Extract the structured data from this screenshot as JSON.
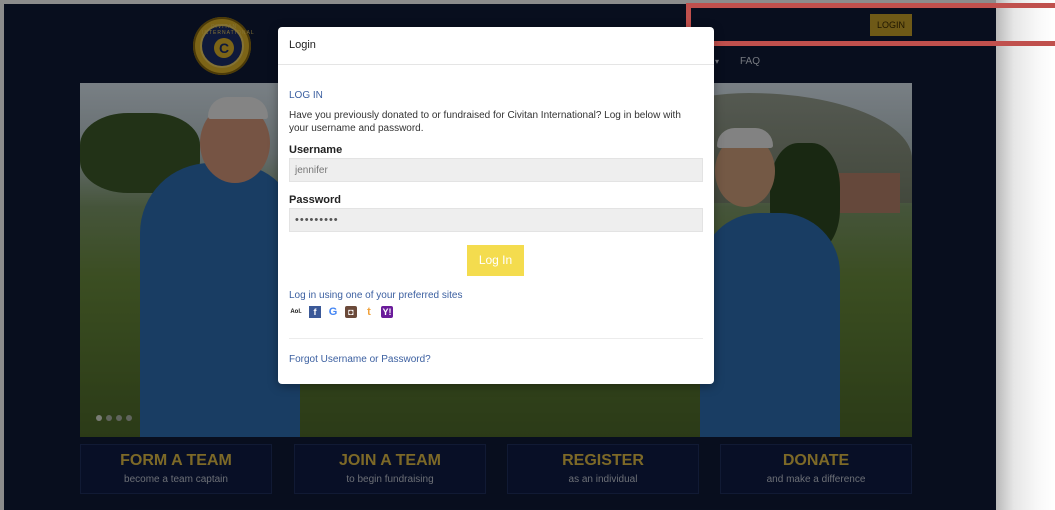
{
  "site": {
    "logo_text": "CIVITAN INTERNATIONAL",
    "logo_letter": "C",
    "nav": {
      "login_label": "LOGIN",
      "faq_label": "FAQ"
    }
  },
  "hero": {
    "slide_dots": 4,
    "active_slide": 1
  },
  "actions": [
    {
      "title": "FORM A TEAM",
      "subtitle": "become a team captain"
    },
    {
      "title": "JOIN A TEAM",
      "subtitle": "to begin fundraising"
    },
    {
      "title": "REGISTER",
      "subtitle": "as an individual"
    },
    {
      "title": "DONATE",
      "subtitle": "and make a difference"
    }
  ],
  "modal": {
    "title": "Login",
    "section_heading": "LOG IN",
    "description": "Have you previously donated to or fundraised for Civitan International? Log in below with your username and password.",
    "username_label": "Username",
    "username_value": "jennifer",
    "password_label": "Password",
    "password_value": "•••••••••",
    "login_button": "Log In",
    "preferred_sites_label": "Log in using one of your preferred sites",
    "social_icons": [
      "aol-icon",
      "facebook-icon",
      "google-icon",
      "instagram-icon",
      "tumblr-icon",
      "yahoo-icon"
    ],
    "forgot_link": "Forgot Username or Password?"
  },
  "colors": {
    "navy": "#0f1b38",
    "gold": "#e3bf48",
    "login_button": "#f4dc4e",
    "link": "#3b5fa0",
    "annotation": "#c0504d"
  }
}
